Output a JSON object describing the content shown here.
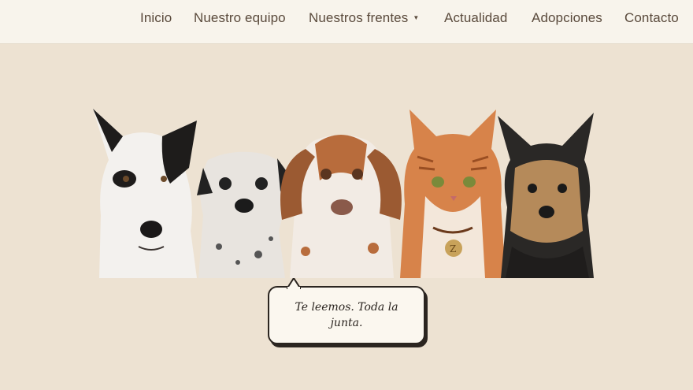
{
  "nav": {
    "items": [
      {
        "label": "Inicio"
      },
      {
        "label": "Nuestro equipo"
      },
      {
        "label": "Nuestros frentes",
        "has_dropdown": true
      },
      {
        "label": "Actualidad"
      },
      {
        "label": "Adopciones"
      },
      {
        "label": "Contacto"
      }
    ]
  },
  "hero": {
    "pets": [
      "dog-black-white",
      "dog-spotted-gray",
      "dog-spaniel-brown",
      "cat-orange-tabby",
      "dog-yorkshire"
    ],
    "bubble_text": "Te leemos. Toda la junta."
  },
  "colors": {
    "background": "#ede2d2",
    "header": "#f8f4ec",
    "nav_text": "#5a4a3c",
    "bubble_border": "#2b2520"
  }
}
